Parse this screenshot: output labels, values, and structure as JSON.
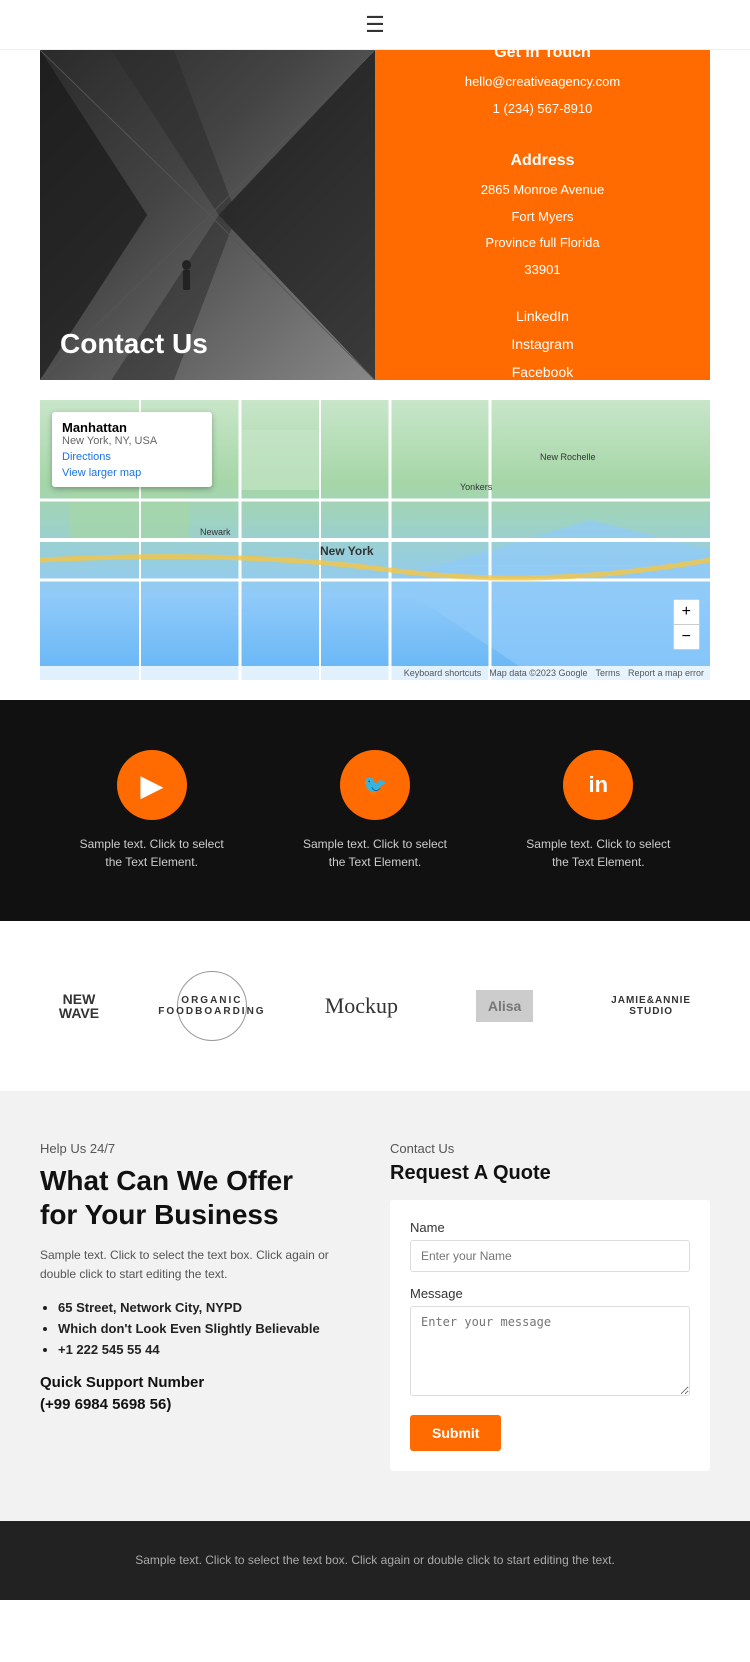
{
  "header": {
    "menu_icon": "☰"
  },
  "contact_hero": {
    "title": "Contact Us",
    "get_in_touch_label": "Get in Touch",
    "email": "hello@creativeagency.com",
    "phone": "1 (234) 567-8910",
    "address_label": "Address",
    "address_lines": [
      "2865 Monroe Avenue",
      "Fort Myers",
      "Province full Florida",
      "33901"
    ],
    "social_links": [
      "LinkedIn",
      "Instagram",
      "Facebook"
    ]
  },
  "map": {
    "location_title": "Manhattan",
    "location_sub": "New York, NY, USA",
    "directions_label": "Directions",
    "view_larger": "View larger map",
    "zoom_in": "+",
    "zoom_out": "−",
    "footer_items": [
      "Keyboard shortcuts",
      "Map data ©2023 Google",
      "Terms",
      "Report a map error"
    ]
  },
  "social_section": {
    "items": [
      {
        "icon": "▶",
        "icon_name": "youtube-icon",
        "text": "Sample text. Click to select the Text Element."
      },
      {
        "icon": "🐦",
        "icon_name": "twitter-icon",
        "text": "Sample text. Click to select the Text Element."
      },
      {
        "icon": "in",
        "icon_name": "linkedin-icon",
        "text": "Sample text. Click to select the Text Element."
      }
    ]
  },
  "logos": {
    "items": [
      {
        "name": "new-wave",
        "label": "NEW\nWAVE"
      },
      {
        "name": "organic",
        "label": "ORGANIC\nFOOD"
      },
      {
        "name": "mockup",
        "label": "Mockup"
      },
      {
        "name": "alisa",
        "label": "Alisa"
      },
      {
        "name": "jamie-annie",
        "label": "JAMIE&ANNIE\nSTUDIO"
      }
    ]
  },
  "offer_section": {
    "help_label": "Help Us 24/7",
    "heading_line1": "What Can We Offer",
    "heading_line2": "for Your Business",
    "description": "Sample text. Click to select the text box. Click again or double click to start editing the text.",
    "list_items": [
      "65 Street, Network City, NYPD",
      "Which don't Look Even Slightly Believable",
      "+1 222 545 55 44"
    ],
    "support_label": "Quick Support Number",
    "support_number": "(+99 6984 5698 56)"
  },
  "contact_form": {
    "contact_label": "Contact Us",
    "form_title": "Request A Quote",
    "name_label": "Name",
    "name_placeholder": "Enter your Name",
    "message_label": "Message",
    "message_placeholder": "Enter your message",
    "submit_label": "Submit"
  },
  "footer": {
    "text": "Sample text. Click to select the text box. Click again or double\nclick to start editing the text."
  }
}
